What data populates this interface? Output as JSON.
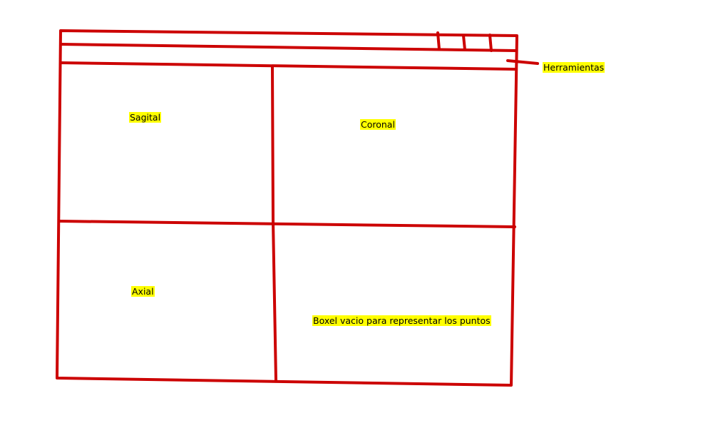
{
  "sketch": {
    "stroke_color": "#cc0000",
    "highlight_color": "#ffff00",
    "text_color": "#000000"
  },
  "labels": {
    "toolbar": "Herramientas",
    "sagittal": "Sagital",
    "coronal": "Coronal",
    "axial": "Axial",
    "voxel_panel": "Boxel vacio para representar los puntos"
  }
}
